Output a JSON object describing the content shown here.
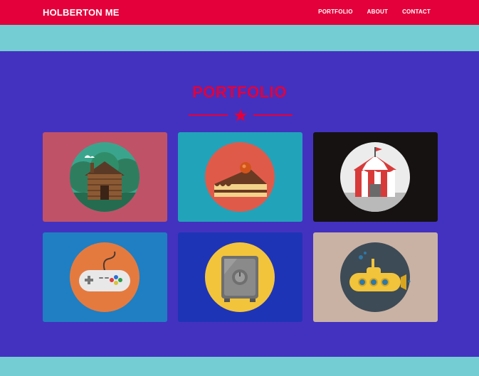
{
  "navbar": {
    "brand": "HOLBERTON ME",
    "links": [
      {
        "label": "PORTFOLIO"
      },
      {
        "label": "ABOUT"
      },
      {
        "label": "CONTACT"
      }
    ]
  },
  "portfolio": {
    "title": "PORTFOLIO",
    "items": [
      {
        "icon": "log-cabin-icon",
        "background": "#c05268"
      },
      {
        "icon": "cake-slice-icon",
        "background": "#21a3ba"
      },
      {
        "icon": "circus-tent-icon",
        "background": "#161212"
      },
      {
        "icon": "game-controller-icon",
        "background": "#1f7fc2"
      },
      {
        "icon": "safe-icon",
        "background": "#1e34b6"
      },
      {
        "icon": "submarine-icon",
        "background": "#c9b2a4"
      }
    ]
  },
  "colors": {
    "navbar": "#e3003b",
    "accent": "#e3003b",
    "teal": "#74cdd3",
    "section_bg": "#4332c0"
  }
}
